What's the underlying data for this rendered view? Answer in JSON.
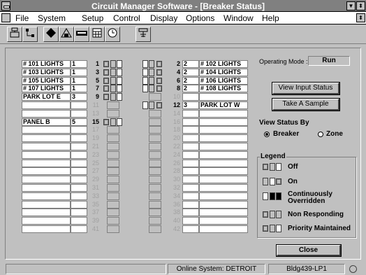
{
  "window": {
    "title": "Circuit Manager Software - [Breaker Status]"
  },
  "menu": [
    "File",
    "System",
    "Setup",
    "Control",
    "Display",
    "Options",
    "Window",
    "Help"
  ],
  "toolbar": [
    "tb1",
    "tb2",
    "tb3",
    "tb4",
    "tb5",
    "tb6",
    "tb7",
    "tb8"
  ],
  "left_rows": [
    {
      "num": "1",
      "label": "# 101 LIGHTS",
      "val": "1",
      "active": true
    },
    {
      "num": "3",
      "label": "# 103 LIGHTS",
      "val": "1",
      "active": true
    },
    {
      "num": "5",
      "label": "# 105 LIGHTS",
      "val": "1",
      "active": true
    },
    {
      "num": "7",
      "label": "# 107 LIGHTS",
      "val": "1",
      "active": true
    },
    {
      "num": "9",
      "label": "PARK LOT E",
      "val": "3",
      "active": true
    },
    {
      "num": "11",
      "label": "",
      "val": "",
      "active": false
    },
    {
      "num": "13",
      "label": "",
      "val": "",
      "active": false
    },
    {
      "num": "15",
      "label": "PANEL B",
      "val": "5",
      "active": true
    },
    {
      "num": "17",
      "label": "",
      "val": "",
      "active": false
    },
    {
      "num": "19",
      "label": "",
      "val": "",
      "active": false
    },
    {
      "num": "21",
      "label": "",
      "val": "",
      "active": false
    },
    {
      "num": "23",
      "label": "",
      "val": "",
      "active": false
    },
    {
      "num": "25",
      "label": "",
      "val": "",
      "active": false
    },
    {
      "num": "27",
      "label": "",
      "val": "",
      "active": false
    },
    {
      "num": "29",
      "label": "",
      "val": "",
      "active": false
    },
    {
      "num": "31",
      "label": "",
      "val": "",
      "active": false
    },
    {
      "num": "33",
      "label": "",
      "val": "",
      "active": false
    },
    {
      "num": "35",
      "label": "",
      "val": "",
      "active": false
    },
    {
      "num": "37",
      "label": "",
      "val": "",
      "active": false
    },
    {
      "num": "39",
      "label": "",
      "val": "",
      "active": false
    },
    {
      "num": "41",
      "label": "",
      "val": "",
      "active": false
    }
  ],
  "right_rows": [
    {
      "num": "2",
      "label": "# 102 LIGHTS",
      "val": "2",
      "active": true
    },
    {
      "num": "4",
      "label": "# 104 LIGHTS",
      "val": "2",
      "active": true
    },
    {
      "num": "6",
      "label": "# 106 LIGHTS",
      "val": "2",
      "active": true
    },
    {
      "num": "8",
      "label": "# 108 LIGHTS",
      "val": "2",
      "active": true
    },
    {
      "num": "10",
      "label": "",
      "val": "",
      "active": false
    },
    {
      "num": "12",
      "label": "PARK LOT W",
      "val": "3",
      "active": true
    },
    {
      "num": "14",
      "label": "",
      "val": "",
      "active": false
    },
    {
      "num": "16",
      "label": "",
      "val": "",
      "active": false
    },
    {
      "num": "18",
      "label": "",
      "val": "",
      "active": false
    },
    {
      "num": "20",
      "label": "",
      "val": "",
      "active": false
    },
    {
      "num": "22",
      "label": "",
      "val": "",
      "active": false
    },
    {
      "num": "24",
      "label": "",
      "val": "",
      "active": false
    },
    {
      "num": "26",
      "label": "",
      "val": "",
      "active": false
    },
    {
      "num": "28",
      "label": "",
      "val": "",
      "active": false
    },
    {
      "num": "30",
      "label": "",
      "val": "",
      "active": false
    },
    {
      "num": "32",
      "label": "",
      "val": "",
      "active": false
    },
    {
      "num": "34",
      "label": "",
      "val": "",
      "active": false
    },
    {
      "num": "36",
      "label": "",
      "val": "",
      "active": false
    },
    {
      "num": "38",
      "label": "",
      "val": "",
      "active": false
    },
    {
      "num": "40",
      "label": "",
      "val": "",
      "active": false
    },
    {
      "num": "42",
      "label": "",
      "val": "",
      "active": false
    }
  ],
  "operating_mode": {
    "label": "Operating Mode :",
    "value": "Run"
  },
  "buttons": {
    "view_input": "View Input Status",
    "take_sample": "Take A Sample",
    "close": "Close"
  },
  "view_status": {
    "title": "View Status By",
    "opt1": "Breaker",
    "opt2": "Zone"
  },
  "legend": {
    "title": "Legend",
    "items": [
      "Off",
      "On",
      "Continuously Overridden",
      "Non Responding",
      "Priority Maintained"
    ]
  },
  "statusbar": {
    "online": "Online System: DETROIT",
    "panel": "Bldg439-LP1"
  }
}
